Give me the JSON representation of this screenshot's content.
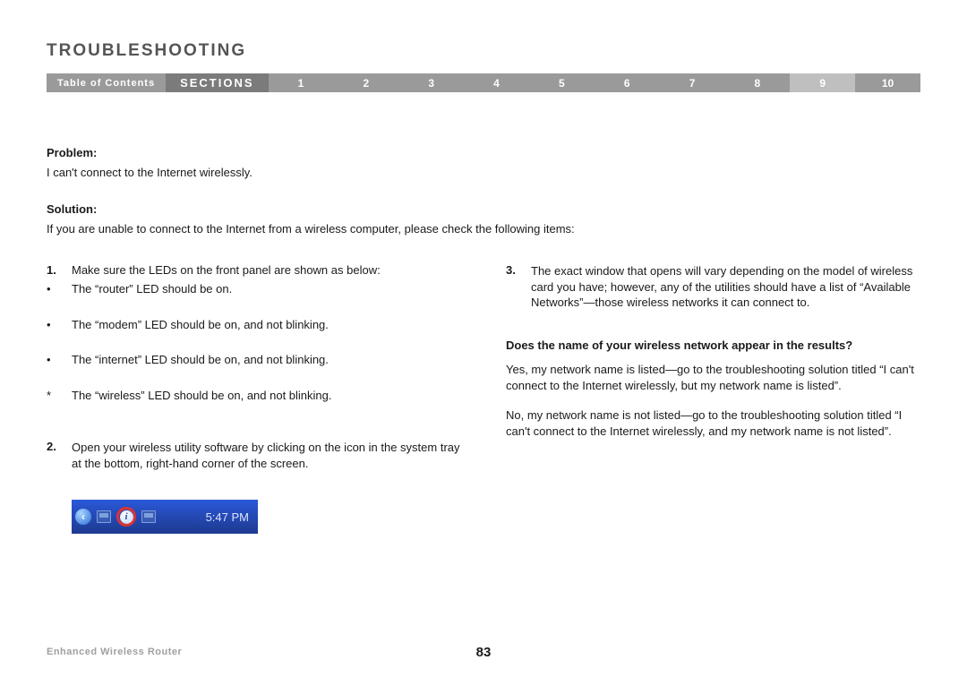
{
  "title": "TROUBLESHOOTING",
  "nav": {
    "toc": "Table of Contents",
    "sections_label": "SECTIONS",
    "items": [
      "1",
      "2",
      "3",
      "4",
      "5",
      "6",
      "7",
      "8",
      "9",
      "10"
    ],
    "active_index": 8
  },
  "problem": {
    "label": "Problem:",
    "text": "I can't connect to the Internet wirelessly."
  },
  "solution": {
    "label": "Solution:",
    "intro": "If you are unable to connect to the Internet from a wireless computer, please check the following items:"
  },
  "left": {
    "step1": {
      "num": "1.",
      "text": "Make sure the LEDs on the front panel are shown as below:",
      "bullets": [
        {
          "mark": "•",
          "text": "The “router” LED should be on."
        },
        {
          "mark": "•",
          "text": "The “modem” LED should be on, and not blinking."
        },
        {
          "mark": "•",
          "text": "The “internet” LED should be on, and not blinking."
        },
        {
          "mark": "*",
          "text": "The “wireless” LED should be on, and not blinking."
        }
      ]
    },
    "step2": {
      "num": "2.",
      "text": "Open your wireless utility software by clicking on the icon in the system tray at the bottom, right-hand corner of the screen."
    },
    "tray_time": "5:47 PM",
    "tray_arrow": "‹"
  },
  "right": {
    "step3": {
      "num": "3.",
      "text": "The exact window that opens will vary depending on the model of wireless card you have; however, any of the utilities should have a list of “Available Networks”—those wireless networks it can connect to."
    },
    "question": "Does the name of your wireless network appear in the results?",
    "ans_yes": "Yes, my network name is listed—go to the troubleshooting solution titled “I can't connect to the Internet wirelessly, but my network name is listed”.",
    "ans_no": "No, my network name is not listed—go to the troubleshooting solution titled “I can't connect to the Internet wirelessly, and my network name is not listed”."
  },
  "footer": {
    "product": "Enhanced Wireless Router",
    "page": "83"
  }
}
